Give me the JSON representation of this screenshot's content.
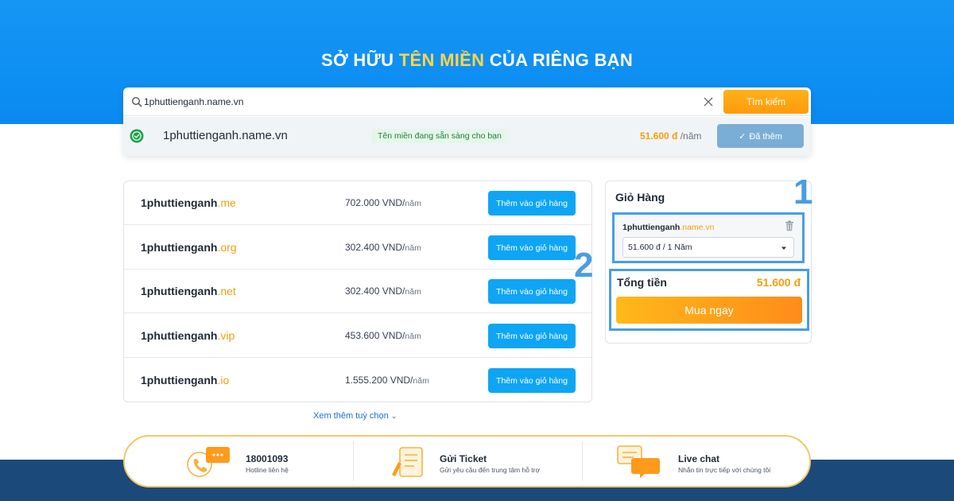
{
  "hero": {
    "title_prefix": "SỞ HỮU",
    "title_highlight": "TÊN MIỀN",
    "title_suffix": "CỦA RIÊNG BẠN",
    "background_color": "#0a8af0",
    "highlight_color": "#ffd54a"
  },
  "search": {
    "value": "1phuttienganh.name.vn",
    "icon": "search-icon",
    "clear_icon": "close-icon",
    "button_label": "Tìm kiếm",
    "button_color": "#ff9a0a"
  },
  "result": {
    "status_icon": "check-circle-icon",
    "domain": "1phuttienganh.name.vn",
    "status_text": "Tên miền đang sẵn sàng cho bạn",
    "price": "51.600 đ",
    "price_unit": "/năm",
    "button_label": "Đã thêm"
  },
  "suggestions": [
    {
      "name": "1phuttienganh",
      "tld": ".me",
      "price": "702.000 VND/",
      "unit": "năm",
      "button_label": "Thêm vào giỏ hàng"
    },
    {
      "name": "1phuttienganh",
      "tld": ".org",
      "price": "302.400 VND/",
      "unit": "năm",
      "button_label": "Thêm vào giỏ hàng"
    },
    {
      "name": "1phuttienganh",
      "tld": ".net",
      "price": "302.400 VND/",
      "unit": "năm",
      "button_label": "Thêm vào giỏ hàng"
    },
    {
      "name": "1phuttienganh",
      "tld": ".vip",
      "price": "453.600 VND/",
      "unit": "năm",
      "button_label": "Thêm vào giỏ hàng"
    },
    {
      "name": "1phuttienganh",
      "tld": ".io",
      "price": "1.555.200 VND/",
      "unit": "năm",
      "button_label": "Thêm vào giỏ hàng"
    }
  ],
  "more_options": {
    "label": "Xem thêm tuỳ chọn",
    "icon": "chevron-down-icon"
  },
  "cart": {
    "title": "Giỏ Hàng",
    "item": {
      "name": "1phuttienganh",
      "tld": ".name.vn",
      "delete_icon": "trash-icon",
      "selected_term": "51.600 đ / 1 Năm"
    },
    "total_label": "Tổng tiền",
    "total_value": "51.600 đ",
    "buy_label": "Mua ngay"
  },
  "markers": {
    "one": "1",
    "two": "2",
    "color": "#4a9de3"
  },
  "support": [
    {
      "icon": "phone-chat-icon",
      "title": "18001093",
      "subtitle": "Hotline liên hệ"
    },
    {
      "icon": "ticket-pen-icon",
      "title": "Gửi Ticket",
      "subtitle": "Gửi yêu cầu đến trung tâm hỗ trợ"
    },
    {
      "icon": "live-chat-icon",
      "title": "Live chat",
      "subtitle": "Nhắn tin trực tiếp với chúng tôi"
    }
  ],
  "colors": {
    "accent_orange": "#f59e0b",
    "action_blue": "#0ea5f5",
    "footer": "#1b4a7a"
  }
}
